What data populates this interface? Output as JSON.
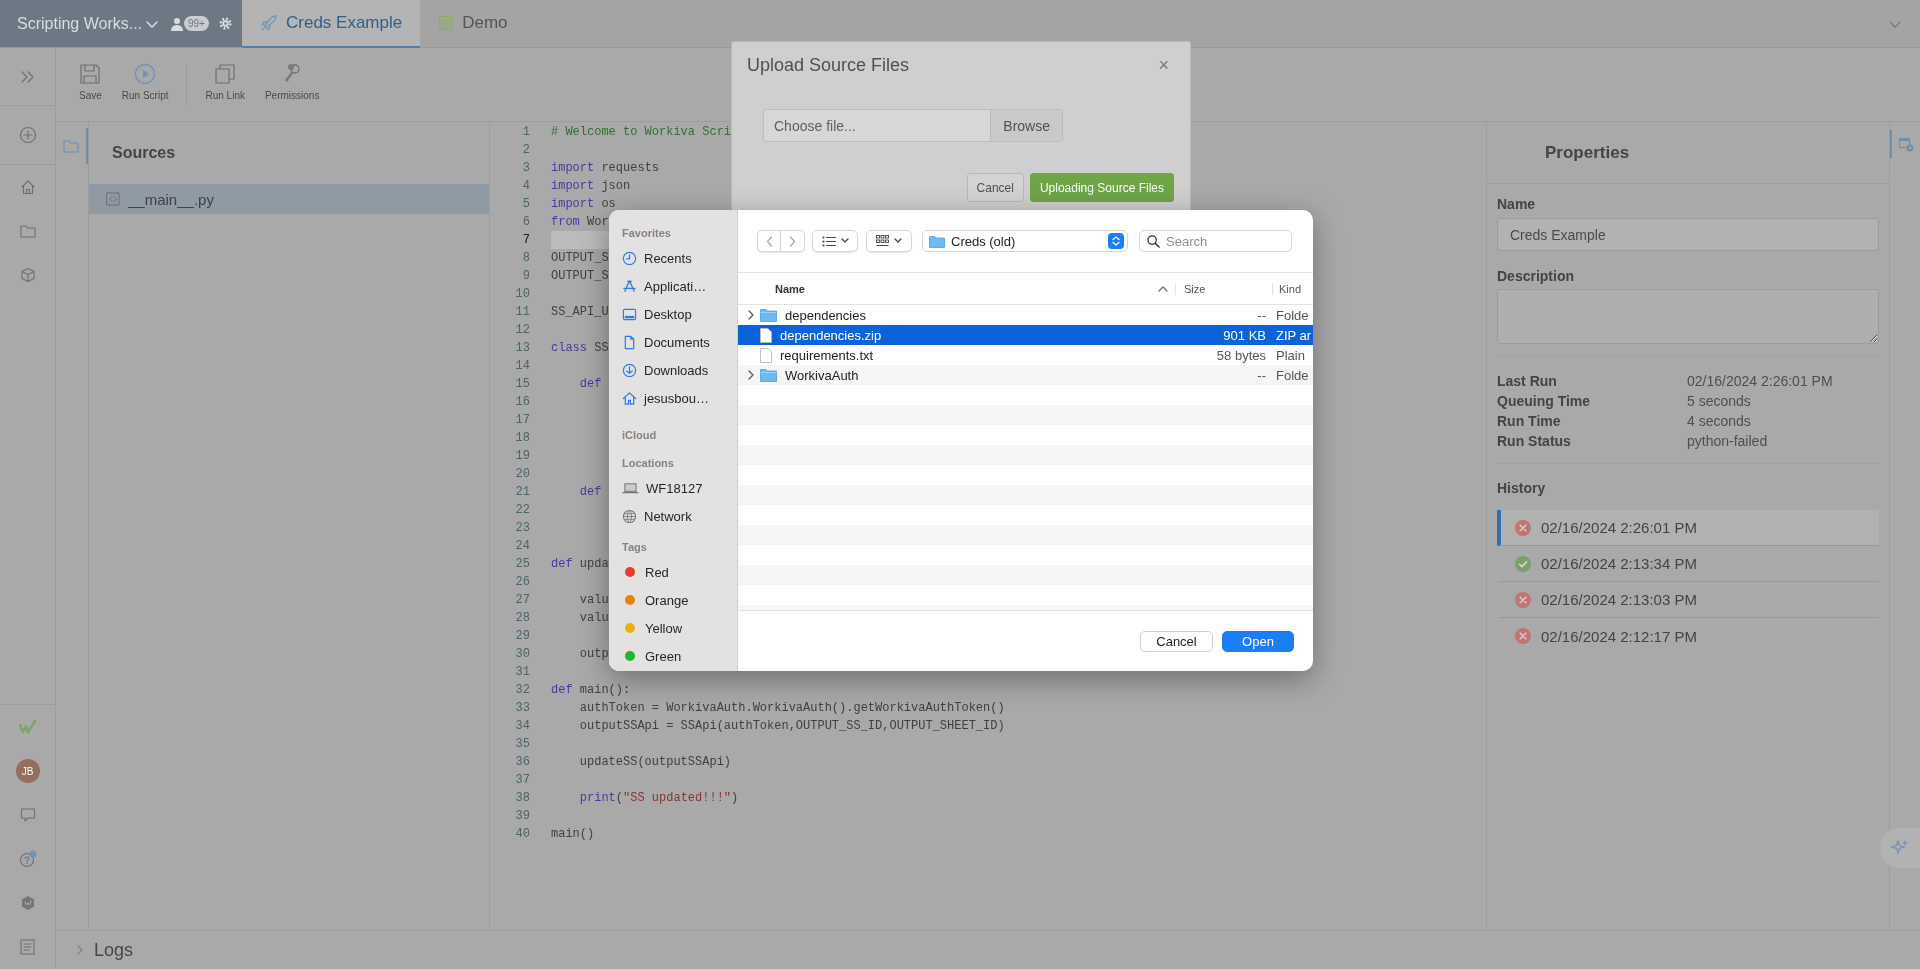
{
  "top_bar": {
    "workspace": "Scripting Works...",
    "user_count": "99+"
  },
  "tabs": [
    {
      "label": "Creds Example",
      "kind": "script",
      "selected": true
    },
    {
      "label": "Demo",
      "kind": "sheet",
      "selected": false
    }
  ],
  "rail": {
    "avatar": "JB"
  },
  "toolbar": {
    "groups": [
      {
        "buttons": [
          {
            "label": "Save",
            "kind": "save"
          },
          {
            "label": "Run Script",
            "kind": "run"
          }
        ]
      },
      {
        "buttons": [
          {
            "label": "Run Link",
            "kind": "link"
          },
          {
            "label": "Permissions",
            "kind": "keys"
          }
        ]
      }
    ]
  },
  "sources": {
    "title": "Sources",
    "files": [
      {
        "name": "__main__.py",
        "selected": true
      }
    ]
  },
  "editor": {
    "lines": [
      {
        "number": "1",
        "current": false,
        "tokens": [
          {
            "kind": "comment",
            "text": "# Welcome to Workiva Scri"
          }
        ]
      },
      {
        "number": "2",
        "current": false
      },
      {
        "number": "3",
        "current": false,
        "tokens": [
          {
            "kind": "keyword",
            "text": "import"
          },
          {
            "kind": "plain",
            "text": " requests"
          }
        ]
      },
      {
        "number": "4",
        "current": false,
        "tokens": [
          {
            "kind": "keyword",
            "text": "import"
          },
          {
            "kind": "plain",
            "text": " json"
          }
        ]
      },
      {
        "number": "5",
        "current": false,
        "tokens": [
          {
            "kind": "keyword",
            "text": "import"
          },
          {
            "kind": "plain",
            "text": " os"
          }
        ]
      },
      {
        "number": "6",
        "current": false,
        "tokens": [
          {
            "kind": "keyword",
            "text": "from"
          },
          {
            "kind": "plain",
            "text": " Wor"
          }
        ]
      },
      {
        "number": "7",
        "current": true
      },
      {
        "number": "8",
        "current": false,
        "tokens": [
          {
            "kind": "plain",
            "text": "OUTPUT_S"
          }
        ]
      },
      {
        "number": "9",
        "current": false,
        "tokens": [
          {
            "kind": "plain",
            "text": "OUTPUT_S"
          }
        ]
      },
      {
        "number": "10",
        "current": false
      },
      {
        "number": "11",
        "current": false,
        "tokens": [
          {
            "kind": "plain",
            "text": "SS_API_U"
          }
        ]
      },
      {
        "number": "12",
        "current": false
      },
      {
        "number": "13",
        "current": false,
        "tokens": [
          {
            "kind": "keyword",
            "text": "class"
          },
          {
            "kind": "plain",
            "text": " SS"
          }
        ]
      },
      {
        "number": "14",
        "current": false
      },
      {
        "number": "15",
        "current": false,
        "tokens": [
          {
            "kind": "keyword",
            "text": "    def"
          }
        ]
      },
      {
        "number": "16",
        "current": false
      },
      {
        "number": "17",
        "current": false
      },
      {
        "number": "18",
        "current": false
      },
      {
        "number": "19",
        "current": false
      },
      {
        "number": "20",
        "current": false
      },
      {
        "number": "21",
        "current": false,
        "tokens": [
          {
            "kind": "keyword",
            "text": "    def"
          }
        ]
      },
      {
        "number": "22",
        "current": false
      },
      {
        "number": "23",
        "current": false
      },
      {
        "number": "24",
        "current": false
      },
      {
        "number": "25",
        "current": false,
        "tokens": [
          {
            "kind": "keyword",
            "text": "def"
          },
          {
            "kind": "plain",
            "text": " upda"
          }
        ]
      },
      {
        "number": "26",
        "current": false
      },
      {
        "number": "27",
        "current": false,
        "tokens": [
          {
            "kind": "plain",
            "text": "    valu"
          }
        ]
      },
      {
        "number": "28",
        "current": false,
        "tokens": [
          {
            "kind": "plain",
            "text": "    valu"
          }
        ]
      },
      {
        "number": "29",
        "current": false
      },
      {
        "number": "30",
        "current": false,
        "tokens": [
          {
            "kind": "plain",
            "text": "    outp"
          }
        ]
      },
      {
        "number": "31",
        "current": false
      },
      {
        "number": "32",
        "current": false,
        "tokens": [
          {
            "kind": "keyword",
            "text": "def"
          },
          {
            "kind": "plain",
            "text": " main():"
          }
        ]
      },
      {
        "number": "33",
        "current": false,
        "tokens": [
          {
            "kind": "plain",
            "text": "    authToken = WorkivaAuth.WorkivaAuth().getWorkivaAuthToken()"
          }
        ]
      },
      {
        "number": "34",
        "current": false,
        "tokens": [
          {
            "kind": "plain",
            "text": "    outputSSApi = SSApi(authToken,OUTPUT_SS_ID,OUTPUT_SHEET_ID)"
          }
        ]
      },
      {
        "number": "35",
        "current": false
      },
      {
        "number": "36",
        "current": false,
        "tokens": [
          {
            "kind": "plain",
            "text": "    updateSS(outputSSApi)"
          }
        ]
      },
      {
        "number": "37",
        "current": false
      },
      {
        "number": "38",
        "current": false,
        "tokens": [
          {
            "kind": "keyword",
            "text": "    print"
          },
          {
            "kind": "plain",
            "text": "("
          },
          {
            "kind": "string",
            "text": "\"SS updated!!!\""
          },
          {
            "kind": "plain",
            "text": ")"
          }
        ]
      },
      {
        "number": "39",
        "current": false
      },
      {
        "number": "40",
        "current": false,
        "tokens": [
          {
            "kind": "plain",
            "text": "main()"
          }
        ]
      }
    ]
  },
  "properties": {
    "title": "Properties",
    "name_label": "Name",
    "name_value": "Creds Example",
    "description_label": "Description",
    "stats": [
      {
        "label": "Last Run",
        "value": "02/16/2024 2:26:01 PM"
      },
      {
        "label": "Queuing Time",
        "value": "5 seconds"
      },
      {
        "label": "Run Time",
        "value": "4 seconds"
      },
      {
        "label": "Run Status",
        "value": "python-failed"
      }
    ],
    "history_title": "History",
    "history": [
      {
        "time": "02/16/2024 2:26:01 PM",
        "kind": "failed",
        "selected": true
      },
      {
        "time": "02/16/2024 2:13:34 PM",
        "kind": "success",
        "selected": false
      },
      {
        "time": "02/16/2024 2:13:03 PM",
        "kind": "failed",
        "selected": false
      },
      {
        "time": "02/16/2024 2:12:17 PM",
        "kind": "failed",
        "selected": false
      }
    ]
  },
  "logs": {
    "label": "Logs"
  },
  "upload_dialog": {
    "title": "Upload Source Files",
    "close": "×",
    "file_placeholder": "Choose file...",
    "browse": "Browse",
    "buttons": [
      {
        "label": "Cancel",
        "primary": false
      },
      {
        "label": "Uploading Source Files",
        "primary": true
      }
    ]
  },
  "file_dialog": {
    "sidebar": [
      {
        "title": "Favorites",
        "items": [
          {
            "label": "Recents",
            "kind": "clock"
          },
          {
            "label": "Applicati…",
            "kind": "apps"
          },
          {
            "label": "Desktop",
            "kind": "desktop"
          },
          {
            "label": "Documents",
            "kind": "document"
          },
          {
            "label": "Downloads",
            "kind": "download"
          },
          {
            "label": "jesusbou…",
            "kind": "home"
          }
        ]
      },
      {
        "title": "iCloud"
      },
      {
        "title": "Locations",
        "items": [
          {
            "label": "WF18127",
            "kind": "computer"
          },
          {
            "label": "Network",
            "kind": "network"
          }
        ]
      },
      {
        "title": "Tags",
        "items": [
          {
            "label": "Red",
            "kind": "tag",
            "color": "#f0382f"
          },
          {
            "label": "Orange",
            "kind": "tag",
            "color": "#ec7f10"
          },
          {
            "label": "Yellow",
            "kind": "tag",
            "color": "#e8b20b"
          },
          {
            "label": "Green",
            "kind": "tag",
            "color": "#20b52e"
          }
        ]
      }
    ],
    "location": "Creds (old)",
    "search_placeholder": "Search",
    "columns": [
      {
        "label": "Name",
        "sorted": true
      },
      {
        "label": "Size",
        "sorted": false
      },
      {
        "label": "Kind",
        "sorted": false
      }
    ],
    "rows": [
      {
        "name": "dependencies",
        "size": "--",
        "kind_label": "Folde",
        "kind": "folder",
        "expandable": true,
        "selected": false
      },
      {
        "name": "dependencies.zip",
        "size": "901 KB",
        "kind_label": "ZIP ar",
        "kind": "file",
        "expandable": false,
        "selected": true
      },
      {
        "name": "requirements.txt",
        "size": "58 bytes",
        "kind_label": "Plain",
        "kind": "file",
        "expandable": false,
        "selected": false
      },
      {
        "name": "WorkivaAuth",
        "size": "--",
        "kind_label": "Folde",
        "kind": "folder",
        "expandable": true,
        "selected": false
      }
    ],
    "buttons": [
      {
        "label": "Cancel",
        "primary": false
      },
      {
        "label": "Open",
        "primary": true
      }
    ]
  }
}
